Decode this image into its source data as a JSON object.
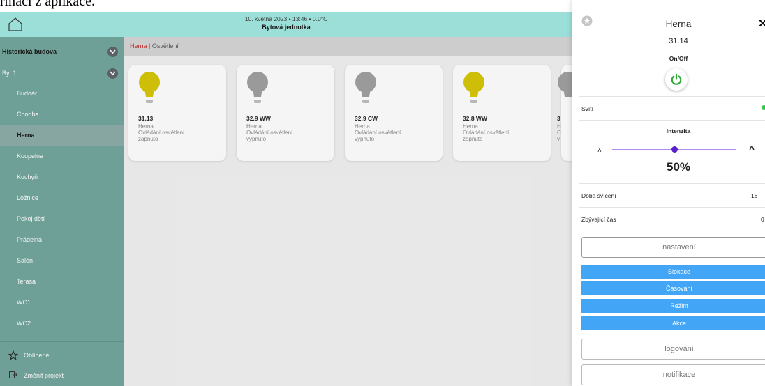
{
  "caption_fragment": "rmaci z aplikace.",
  "header": {
    "date_line": "10. května 2023 • 13:46 • 0.0°C",
    "title": "Bytová jednotka"
  },
  "sidebar": {
    "building": "Historická budova",
    "apartment": "Byt 1",
    "rooms": [
      "Budoár",
      "Chodba",
      "Herna",
      "Koupelna",
      "Kuchyň",
      "Ložnice",
      "Pokoj dětí",
      "Prádelna",
      "Salón",
      "Terasa",
      "WC1",
      "WC2"
    ],
    "active_room": "Herna",
    "favorites_label": "Oblíbené",
    "change_project_label": "Změnit projekt"
  },
  "breadcrumb": {
    "room": "Herna",
    "separator": "|",
    "section": "Osvětlení"
  },
  "cards": [
    {
      "name": "31.13",
      "room": "Herna",
      "type": "Ovládání osvětlení",
      "state": "zapnuto",
      "on": true
    },
    {
      "name": "32.9 WW",
      "room": "Herna",
      "type": "Ovládání osvětlení",
      "state": "vypnuto",
      "on": false
    },
    {
      "name": "32.9 CW",
      "room": "Herna",
      "type": "Ovládání osvětlení",
      "state": "vypnuto",
      "on": false
    },
    {
      "name": "32.8 WW",
      "room": "Herna",
      "type": "Ovládání osvětlení",
      "state": "zapnuto",
      "on": true
    },
    {
      "name": "3",
      "room": "H",
      "type": "C",
      "state": "v",
      "on": false
    }
  ],
  "panel": {
    "title": "Herna",
    "device_id": "31.14",
    "device_type": "On/Off",
    "status_label": "Svítí",
    "intensity_label": "Intenzita",
    "intensity_value": "50%",
    "intensity_fraction": 0.5,
    "lighting_time_label": "Doba svícení",
    "lighting_time_value": "16",
    "remaining_time_label": "Zbývající čas",
    "remaining_time_value": "0",
    "settings_button": "nastavení",
    "blue_buttons": [
      "Blokace",
      "Časování",
      "Režim",
      "Akce"
    ],
    "logging_button": "logování",
    "notifications_button": "notifikace"
  },
  "colors": {
    "header_bg": "#9fe8e0",
    "sidebar_bg": "#6fa49a",
    "bulb_on": "#d6c400",
    "bulb_off": "#9e9e9e",
    "power_green": "#2eab3c",
    "accent_blue": "#42a5f5",
    "slider_purple": "#5a1fcc"
  }
}
